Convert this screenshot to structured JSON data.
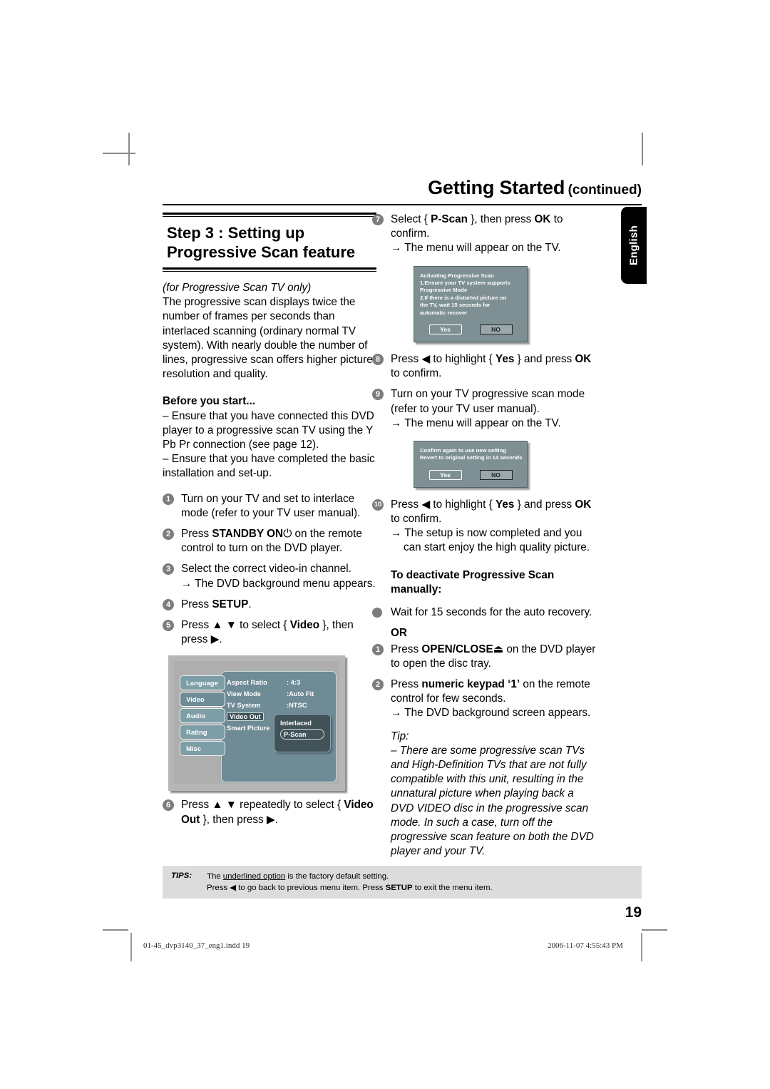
{
  "header": {
    "title": "Getting Started",
    "continued": "(continued)",
    "side_tab": "English"
  },
  "left_column": {
    "step_heading_line1": "Step 3 : Setting up",
    "step_heading_line2": "Progressive Scan feature",
    "intro_italic": "(for Progressive Scan TV only)",
    "intro_body": "The progressive scan displays twice the number of frames per seconds than interlaced scanning (ordinary normal TV system). With nearly double the number of lines, progressive scan offers higher picture resolution and quality.",
    "before_heading": "Before you start...",
    "before_item1": "– Ensure that you have connected this DVD player to a progressive scan TV using the Y Pb Pr connection (see page 12).",
    "before_item2": "– Ensure that you have completed the basic installation and set-up.",
    "steps": [
      {
        "num": "1",
        "text": "Turn on your TV and set to interlace mode (refer to your TV user manual)."
      },
      {
        "num": "2",
        "pre": "Press ",
        "bold": "STANDBY ON",
        "icon": "⏻",
        "post": " on the remote control to turn on the DVD player."
      },
      {
        "num": "3",
        "text": "Select the correct video-in channel.",
        "arrow": "→ The DVD background menu appears."
      },
      {
        "num": "4",
        "pre": "Press ",
        "bold": "SETUP",
        "post": "."
      },
      {
        "num": "5",
        "pre": "Press ▲ ▼ to select { ",
        "bold": "Video",
        "post": " }, then press ▶."
      },
      {
        "num": "6",
        "pre": "Press ▲ ▼ repeatedly to select { ",
        "bold": "Video Out",
        "post": " }, then press ▶."
      }
    ]
  },
  "setup_menu_graphic": {
    "tabs": [
      "Language",
      "Video",
      "Audio",
      "Rating",
      "Misc"
    ],
    "active_tab": "Video",
    "rows": [
      {
        "label": "Aspect Ratio",
        "value": ": 4:3"
      },
      {
        "label": "View Mode",
        "value": ":Auto Fit"
      },
      {
        "label": "TV System",
        "value": ":NTSC"
      },
      {
        "label": "Video Out",
        "value": ""
      },
      {
        "label": "Smart Picture",
        "value": ""
      }
    ],
    "selected_row": "Video Out",
    "submenu_options": [
      "Interlaced",
      "P-Scan"
    ],
    "submenu_highlighted": "P-Scan"
  },
  "right_column": {
    "steps": [
      {
        "num": "7",
        "pre": "Select { ",
        "bold": "P-Scan",
        "mid": " }, then press ",
        "bold2": "OK",
        "post": " to confirm.",
        "arrow": "→ The menu will appear on the TV."
      },
      {
        "num": "8",
        "pre": "Press ◀ to highlight { ",
        "bold": "Yes",
        "mid": " } and press ",
        "bold2": "OK",
        "post": " to confirm."
      },
      {
        "num": "9",
        "text": "Turn on your TV progressive scan mode (refer to your TV user manual).",
        "arrow": "→ The menu will appear on the TV."
      },
      {
        "num": "10",
        "pre": "Press ◀ to highlight { ",
        "bold": "Yes",
        "mid": " } and press ",
        "bold2": "OK",
        "post": " to confirm.",
        "arrow": "→ The setup is now completed and you can start enjoy the high quality picture."
      }
    ],
    "deactivate_heading_line1": "To deactivate Progressive Scan",
    "deactivate_heading_line2": "manually:",
    "bullet_item": "Wait for 15 seconds for the auto recovery.",
    "or_label": "OR",
    "manual_steps": [
      {
        "num": "1",
        "pre": "Press ",
        "bold": "OPEN/CLOSE",
        "icon": "⏏",
        "post": " on the DVD player to open the disc tray."
      },
      {
        "num": "2",
        "pre": "Press ",
        "bold": "numeric keypad ‘1’",
        "post": " on the remote control for few seconds.",
        "arrow": "→ The DVD background screen appears."
      }
    ],
    "tip_label": "Tip:",
    "tip_text": "– There are some progressive scan TVs and High-Definition TVs that are not fully compatible with this unit, resulting in the unnatural picture when playing back a DVD VIDEO disc in the progressive scan mode. In such a case, turn off the progressive scan feature on both the DVD player and your TV."
  },
  "tv_dialog_1": {
    "lines": [
      "Activating Progressive Scan",
      "1.Ensure your TV system supports",
      "Progressive Mode",
      "2.If there is a distorted picture on",
      "the TV, wait 15 seconds for",
      "automatic recover"
    ],
    "yes_label": "Yes",
    "no_label": "NO"
  },
  "tv_dialog_2": {
    "lines": [
      "Confirm again to use new setting",
      "Revert to original setting in 14 seconds"
    ],
    "yes_label": "Yes",
    "no_label": "NO"
  },
  "tips_footer": {
    "label": "TIPS:",
    "line1_pre": "The ",
    "line1_underlined": "underlined option",
    "line1_post": " is the factory default setting.",
    "line2_pre": "Press  ◀ to go back to previous menu item. Press ",
    "line2_bold": "SETUP",
    "line2_post": " to exit the menu item."
  },
  "page_number": "19",
  "printer_footer": {
    "file": "01-45_dvp3140_37_eng1.indd  19",
    "timestamp": "2006-11-07   4:55:43 PM"
  }
}
